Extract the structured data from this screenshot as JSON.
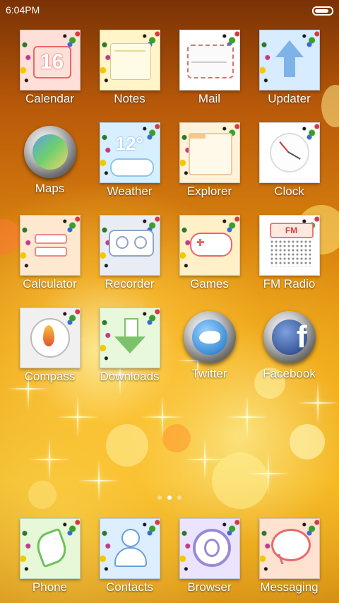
{
  "status_bar": {
    "time": "6:04PM",
    "battery_level": 0.85
  },
  "apps": [
    {
      "label": "Calendar",
      "icon": "calendar-icon",
      "tile_color": "#ffe0d8",
      "glyph": "16"
    },
    {
      "label": "Notes",
      "icon": "notes-icon",
      "tile_color": "#fff5c8",
      "glyph": ""
    },
    {
      "label": "Mail",
      "icon": "mail-icon",
      "tile_color": "#ffffff",
      "glyph": ""
    },
    {
      "label": "Updater",
      "icon": "updater-icon",
      "tile_color": "#d8ecff",
      "glyph": ""
    },
    {
      "label": "Maps",
      "icon": "maps-icon",
      "tile_color": "round",
      "glyph": ""
    },
    {
      "label": "Weather",
      "icon": "weather-icon",
      "tile_color": "#d8efff",
      "glyph": "12°"
    },
    {
      "label": "Explorer",
      "icon": "explorer-icon",
      "tile_color": "#fff2d8",
      "glyph": ""
    },
    {
      "label": "Clock",
      "icon": "clock-icon",
      "tile_color": "#ffffff",
      "glyph": ""
    },
    {
      "label": "Calculator",
      "icon": "calculator-icon",
      "tile_color": "#ffe8d0",
      "glyph": ""
    },
    {
      "label": "Recorder",
      "icon": "recorder-icon",
      "tile_color": "#e8ecf5",
      "glyph": ""
    },
    {
      "label": "Games",
      "icon": "games-icon",
      "tile_color": "#fff0c8",
      "glyph": ""
    },
    {
      "label": "FM Radio",
      "icon": "fm-radio-icon",
      "tile_color": "#ffffff",
      "glyph": "FM"
    },
    {
      "label": "Compass",
      "icon": "compass-icon",
      "tile_color": "#f0f0f0",
      "glyph": ""
    },
    {
      "label": "Downloads",
      "icon": "downloads-icon",
      "tile_color": "#e8f8dc",
      "glyph": ""
    },
    {
      "label": "Twitter",
      "icon": "twitter-icon",
      "tile_color": "round",
      "glyph": ""
    },
    {
      "label": "Facebook",
      "icon": "facebook-icon",
      "tile_color": "round",
      "glyph": "f"
    }
  ],
  "dock": [
    {
      "label": "Phone",
      "icon": "phone-icon",
      "tile_color": "#e6f8d8"
    },
    {
      "label": "Contacts",
      "icon": "contacts-icon",
      "tile_color": "#dceeff"
    },
    {
      "label": "Browser",
      "icon": "browser-icon",
      "tile_color": "#ece4ff"
    },
    {
      "label": "Messaging",
      "icon": "messaging-icon",
      "tile_color": "#ffe2d0"
    }
  ],
  "page_indicator": {
    "pages": 3,
    "current": 2
  }
}
